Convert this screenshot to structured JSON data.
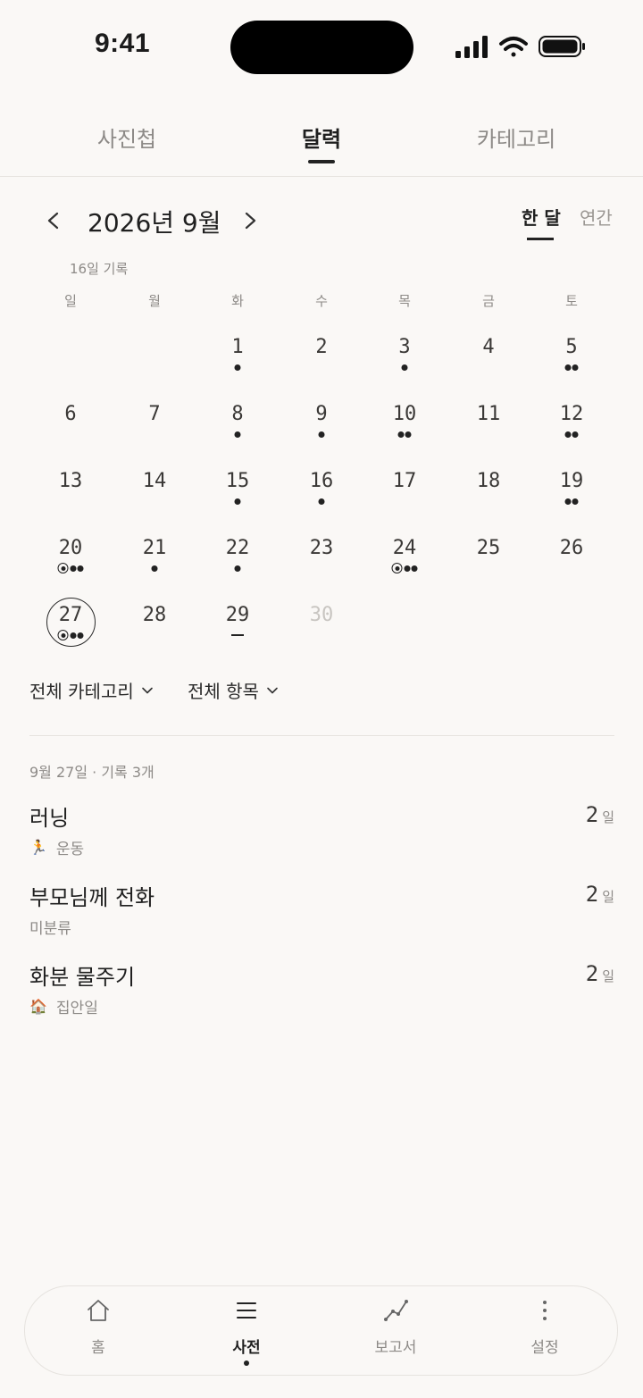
{
  "status_bar": {
    "time": "9:41"
  },
  "top_tabs": [
    {
      "label": "사진첩",
      "active": false
    },
    {
      "label": "달력",
      "active": true
    },
    {
      "label": "카테고리",
      "active": false
    }
  ],
  "calendar": {
    "month_title": "2026년 9월",
    "view_toggles": [
      {
        "label": "한 달",
        "active": true
      },
      {
        "label": "연간",
        "active": false
      }
    ],
    "record_count": "16일 기록",
    "weekdays": [
      "일",
      "월",
      "화",
      "수",
      "목",
      "금",
      "토"
    ],
    "days": [
      {
        "day": "1",
        "markers": [
          "dot"
        ]
      },
      {
        "day": "2",
        "markers": []
      },
      {
        "day": "3",
        "markers": [
          "dot"
        ]
      },
      {
        "day": "4",
        "markers": []
      },
      {
        "day": "5",
        "markers": [
          "dot",
          "dot"
        ]
      },
      {
        "day": "6",
        "markers": []
      },
      {
        "day": "7",
        "markers": []
      },
      {
        "day": "8",
        "markers": [
          "dot"
        ]
      },
      {
        "day": "9",
        "markers": [
          "dot"
        ]
      },
      {
        "day": "10",
        "markers": [
          "dot",
          "dot"
        ]
      },
      {
        "day": "11",
        "markers": []
      },
      {
        "day": "12",
        "markers": [
          "dot",
          "dot"
        ]
      },
      {
        "day": "13",
        "markers": []
      },
      {
        "day": "14",
        "markers": []
      },
      {
        "day": "15",
        "markers": [
          "dot"
        ]
      },
      {
        "day": "16",
        "markers": [
          "dot"
        ]
      },
      {
        "day": "17",
        "markers": []
      },
      {
        "day": "18",
        "markers": []
      },
      {
        "day": "19",
        "markers": [
          "dot",
          "dot"
        ]
      },
      {
        "day": "20",
        "markers": [
          "target",
          "dot",
          "dot"
        ]
      },
      {
        "day": "21",
        "markers": [
          "dot"
        ]
      },
      {
        "day": "22",
        "markers": [
          "dot"
        ]
      },
      {
        "day": "23",
        "markers": []
      },
      {
        "day": "24",
        "markers": [
          "target",
          "dot",
          "dot"
        ]
      },
      {
        "day": "25",
        "markers": []
      },
      {
        "day": "26",
        "markers": []
      },
      {
        "day": "27",
        "markers": [
          "target",
          "dot",
          "dot"
        ],
        "today": true
      },
      {
        "day": "28",
        "markers": []
      },
      {
        "day": "29",
        "markers": [
          "dash"
        ]
      },
      {
        "day": "30",
        "markers": [],
        "future": true
      }
    ],
    "first_weekday_index": 2
  },
  "filters": {
    "category": "전체 카테고리",
    "item": "전체 항목"
  },
  "list": {
    "header": "9월 27일 · 기록 3개",
    "items": [
      {
        "title": "러닝",
        "category": "운동",
        "category_icon": "🏃",
        "count": "2",
        "unit": "일"
      },
      {
        "title": "부모님께 전화",
        "category": "미분류",
        "category_icon": "",
        "count": "2",
        "unit": "일"
      },
      {
        "title": "화분 물주기",
        "category": "집안일",
        "category_icon": "🏠",
        "count": "2",
        "unit": "일"
      }
    ]
  },
  "bottom_nav": [
    {
      "label": "홈",
      "icon": "home-icon",
      "active": false
    },
    {
      "label": "사전",
      "icon": "menu-icon",
      "active": true
    },
    {
      "label": "보고서",
      "icon": "chart-icon",
      "active": false
    },
    {
      "label": "설정",
      "icon": "more-vertical-icon",
      "active": false
    }
  ]
}
